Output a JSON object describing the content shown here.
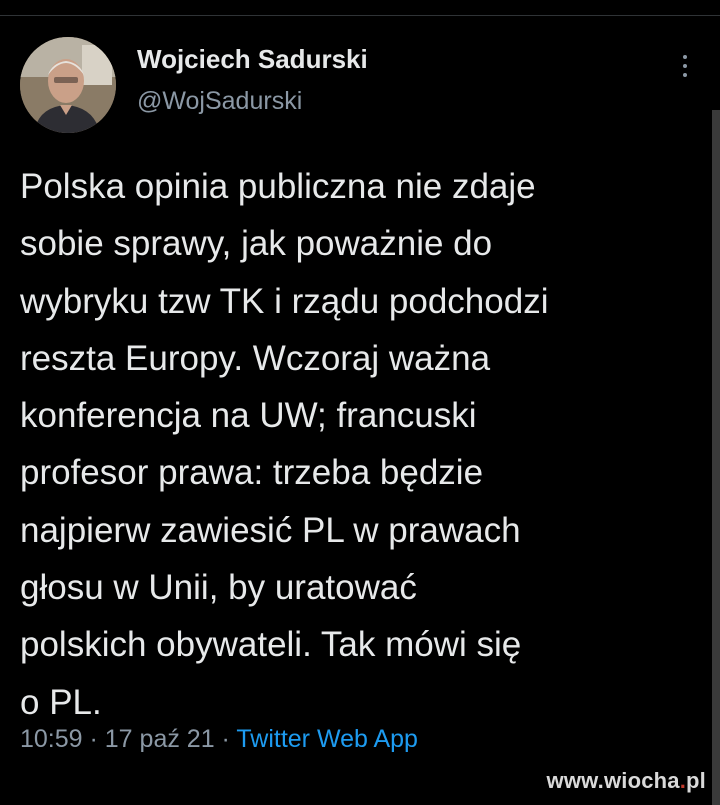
{
  "tweet": {
    "author_name": "Wojciech Sadurski",
    "author_handle": "@WojSadurski",
    "text": "Polska opinia publiczna nie zdaje\nsobie sprawy, jak poważnie do\nwybryku tzw TK i rządu podchodzi\nreszta Europy. Wczoraj ważna\nkonferencja na UW; francuski\nprofesor prawa: trzeba będzie\nnajpierw zawiesić PL w prawach\ngłosu w Unii, by uratować\npolskich obywateli. Tak mówi się\no PL.",
    "time": "10:59",
    "separator": " · ",
    "date": "17 paź 21",
    "source": "Twitter Web App"
  },
  "watermark": {
    "prefix": "www.wiocha",
    "dot": ".",
    "suffix": "pl"
  },
  "icons": {
    "more": "more-vertical-icon",
    "avatar": "profile-photo"
  },
  "colors": {
    "background": "#000000",
    "text": "#e7e9ea",
    "muted": "#8b98a5",
    "link": "#1d9bf0"
  }
}
